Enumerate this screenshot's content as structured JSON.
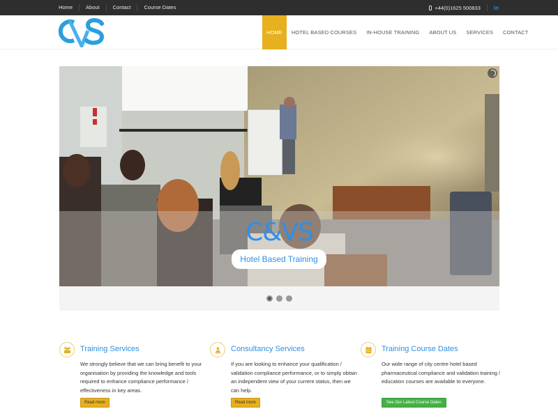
{
  "topbar": {
    "links": [
      "Home",
      "About",
      "Contact",
      "Course Dates"
    ],
    "phone": "+44(0)1625 500833",
    "social": "in"
  },
  "header": {
    "logo_text": "CVS",
    "nav": [
      "HOME",
      "HOTEL BASED COURSES",
      "IN-HOUSE TRAINING",
      "ABOUT US",
      "SERVICES",
      "CONTACT"
    ],
    "active_nav": "HOME"
  },
  "hero": {
    "title": "C&VS",
    "subtitle": "Hotel Based Training",
    "slide_count": 3,
    "active_slide": 1
  },
  "features": [
    {
      "icon": "group-icon",
      "title": "Training Services",
      "text": "We strongly believe that we can bring benefit to your organisation by providing the knowledge and tools required to enhance compliance performance / effectiveness in key areas.",
      "button": "Read more"
    },
    {
      "icon": "user-icon",
      "title": "Consultancy Services",
      "text": "If you are looking to enhance your qualification / validation compliance performance, or to simply obtain an independent view of your current status, then we can help.",
      "button": "Read more"
    },
    {
      "icon": "calendar-icon",
      "title": "Training Course Dates",
      "text": "Our wide range of city centre hotel based pharmaceutical compliance and validation training / education courses are available to everyone.",
      "button": "See Our Latest Course Dates"
    }
  ],
  "colors": {
    "accent_yellow": "#e6b01e",
    "brand_blue": "#2f8fe0",
    "button_green": "#45b046",
    "topbar_bg": "#2e2e2e"
  }
}
